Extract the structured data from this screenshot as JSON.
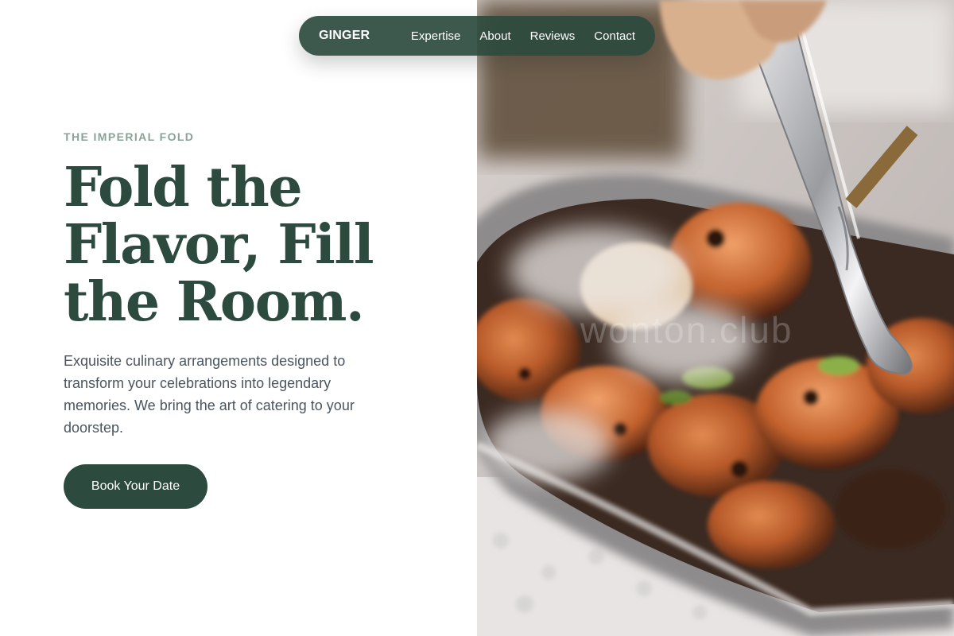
{
  "nav": {
    "brand": "GINGER",
    "links": [
      "Expertise",
      "About",
      "Reviews",
      "Contact"
    ]
  },
  "hero": {
    "eyebrow": "THE IMPERIAL FOLD",
    "headline_lines": [
      "Fold the",
      "Flavor, Fill",
      "the Room."
    ],
    "description": "Exquisite culinary arrangements designed to transform your celebrations into legendary memories. We bring the art of catering to your doorstep.",
    "cta_label": "Book Your Date"
  },
  "image": {
    "watermark": "wonton.club"
  },
  "colors": {
    "primary": "#2d4a3e",
    "eyebrow": "#8aa396",
    "body_text": "#4a5560",
    "background": "#ffffff"
  }
}
